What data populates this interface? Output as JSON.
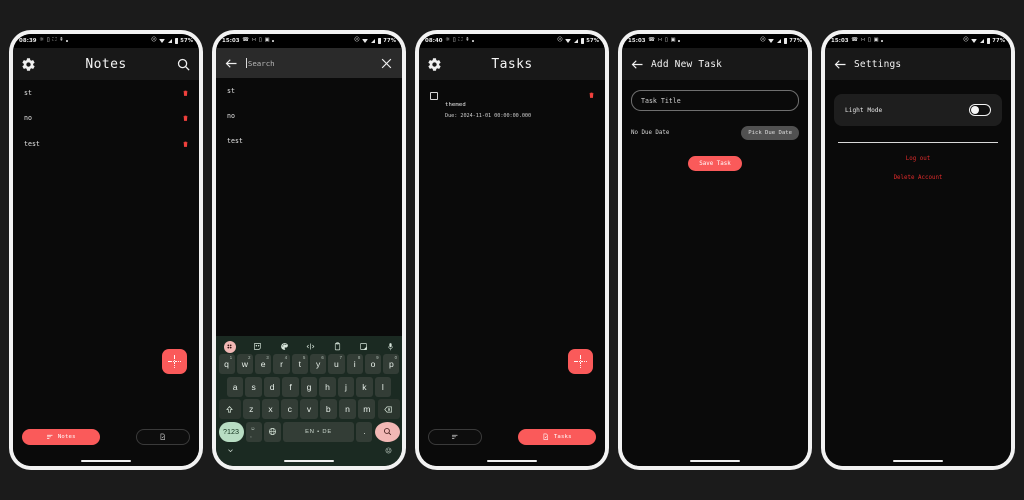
{
  "theme": {
    "accent": "#FA5A5A",
    "danger": "#E02B2B",
    "trash": "#F0403C",
    "screen_bg": "#0A0A0A",
    "appbar_bg": "#181818",
    "keyboard_bg": "#1B2A22",
    "keyboard_key": "#333D36",
    "keyboard_accent_key": "#B8DDC3",
    "keyboard_enter": "#F2B8B5",
    "frame": "#F2F2F2",
    "canvas_bg": "#1B1B1B"
  },
  "screens": [
    {
      "id": "notes",
      "status_bar": {
        "clock": "08:39",
        "left_icons": [
          "nfc-icon",
          "message-icon",
          "mail-icon",
          "bluetooth-icon",
          "dot-icon"
        ],
        "right_icons": [
          "vibrate-off-icon",
          "wifi-icon",
          "signal-icon",
          "battery-icon"
        ],
        "battery": "57%"
      },
      "appbar": {
        "title": "Notes",
        "leading_icon": "gear-icon",
        "trailing_icon": "search-icon"
      },
      "notes": [
        {
          "title": "st",
          "delete_icon": "trash-icon"
        },
        {
          "title": "no",
          "delete_icon": "trash-icon"
        },
        {
          "title": "test",
          "delete_icon": "trash-icon"
        }
      ],
      "fab": {
        "icon": "add-plus-icon"
      },
      "bottom_nav": [
        {
          "label": "Notes",
          "icon": "notes-lines-icon",
          "selected": true
        },
        {
          "label": "",
          "icon": "task-document-icon",
          "selected": false
        }
      ]
    },
    {
      "id": "search",
      "status_bar": {
        "clock": "15:03",
        "left_icons": [
          "whatsapp-icon",
          "share-icon",
          "message-icon",
          "app-icon",
          "dot-icon"
        ],
        "right_icons": [
          "vibrate-off-icon",
          "wifi-icon",
          "signal-icon",
          "battery-icon"
        ],
        "battery": "77%"
      },
      "search_bar": {
        "back_icon": "arrow-back-icon",
        "placeholder": "Search",
        "value": "",
        "clear_icon": "close-x-icon"
      },
      "results": [
        {
          "title": "st"
        },
        {
          "title": "no"
        },
        {
          "title": "test"
        }
      ],
      "keyboard": {
        "toolbar_icons": [
          "apps-grid-icon",
          "sticker-icon",
          "palette-icon",
          "text-edit-icon",
          "clipboard-icon",
          "translate-icon",
          "microphone-icon"
        ],
        "row1": [
          {
            "key": "q",
            "num": "1"
          },
          {
            "key": "w",
            "num": "2"
          },
          {
            "key": "e",
            "num": "3"
          },
          {
            "key": "r",
            "num": "4"
          },
          {
            "key": "t",
            "num": "5"
          },
          {
            "key": "y",
            "num": "6"
          },
          {
            "key": "u",
            "num": "7"
          },
          {
            "key": "i",
            "num": "8"
          },
          {
            "key": "o",
            "num": "9"
          },
          {
            "key": "p",
            "num": "0"
          }
        ],
        "row2": [
          "a",
          "s",
          "d",
          "f",
          "g",
          "h",
          "j",
          "k",
          "l"
        ],
        "row3": [
          "z",
          "x",
          "c",
          "v",
          "b",
          "n",
          "m"
        ],
        "shift_icon": "shift-up-icon",
        "backspace_icon": "backspace-icon",
        "symbols_key": "?123",
        "emoji_sub_key": ",",
        "globe_icon": "language-globe-icon",
        "space_label": "EN • DE",
        "period_key": ".",
        "enter_icon": "search-enter-icon",
        "collapse_icon": "chevron-down-icon",
        "emoji_icon": "emoji-face-icon"
      }
    },
    {
      "id": "tasks",
      "status_bar": {
        "clock": "08:40",
        "left_icons": [
          "nfc-icon",
          "message-icon",
          "mail-icon",
          "bluetooth-icon",
          "dot-icon"
        ],
        "right_icons": [
          "vibrate-off-icon",
          "wifi-icon",
          "signal-icon",
          "battery-icon"
        ],
        "battery": "57%"
      },
      "appbar": {
        "title": "Tasks",
        "leading_icon": "gear-icon"
      },
      "tasks": [
        {
          "name": "themed",
          "due": "Due: 2024-11-01 00:00:00.000",
          "checked": false,
          "delete_icon": "trash-icon"
        }
      ],
      "fab": {
        "icon": "add-plus-icon"
      },
      "bottom_nav": [
        {
          "label": "",
          "icon": "notes-lines-icon",
          "selected": false
        },
        {
          "label": "Tasks",
          "icon": "task-document-icon",
          "selected": true
        }
      ]
    },
    {
      "id": "add-new-task",
      "status_bar": {
        "clock": "15:03",
        "left_icons": [
          "whatsapp-icon",
          "share-icon",
          "message-icon",
          "app-icon",
          "dot-icon"
        ],
        "right_icons": [
          "vibrate-off-icon",
          "wifi-icon",
          "signal-icon",
          "battery-icon"
        ],
        "battery": "77%"
      },
      "appbar": {
        "title": "Add New Task",
        "leading_icon": "arrow-back-icon"
      },
      "form": {
        "title_placeholder": "Task Title",
        "title_value": "",
        "due_status": "No Due Date",
        "pick_date_label": "Pick Due Date",
        "save_label": "Save Task"
      }
    },
    {
      "id": "settings",
      "status_bar": {
        "clock": "15:03",
        "left_icons": [
          "whatsapp-icon",
          "share-icon",
          "message-icon",
          "app-icon",
          "dot-icon"
        ],
        "right_icons": [
          "vibrate-off-icon",
          "wifi-icon",
          "signal-icon",
          "battery-icon"
        ],
        "battery": "77%"
      },
      "appbar": {
        "title": "Settings",
        "leading_icon": "arrow-back-icon"
      },
      "options": {
        "light_mode_label": "Light Mode",
        "light_mode_on": false
      },
      "actions": {
        "logout_label": "Log out",
        "delete_label": "Delete Account"
      }
    }
  ]
}
